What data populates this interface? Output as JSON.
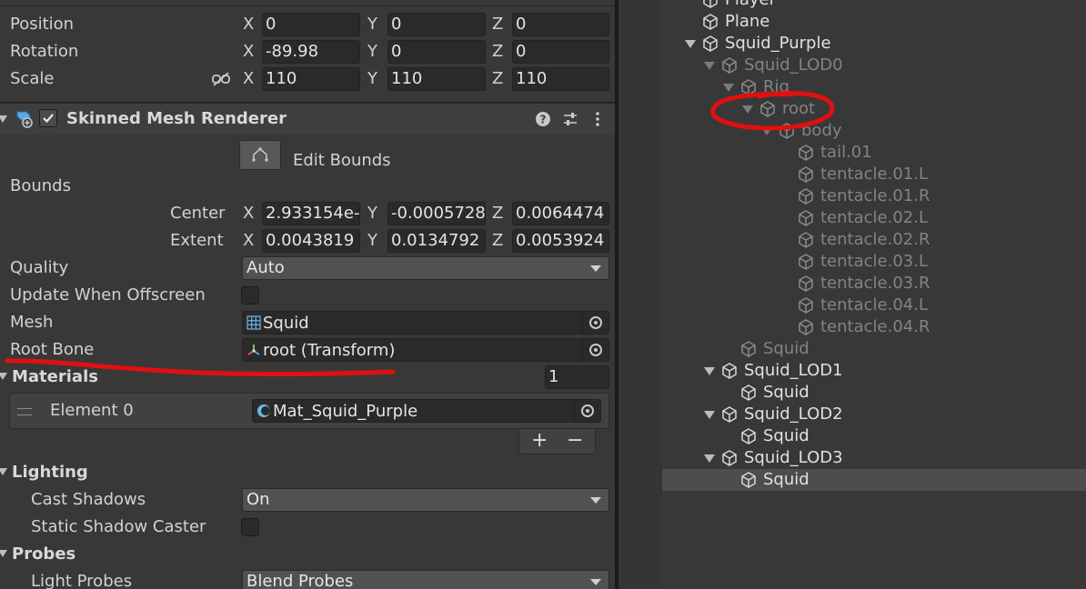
{
  "transform": {
    "position": {
      "label": "Position",
      "x": "0",
      "y": "0",
      "z": "0"
    },
    "rotation": {
      "label": "Rotation",
      "x": "-89.98",
      "y": "0",
      "z": "0"
    },
    "scale": {
      "label": "Scale",
      "x": "110",
      "y": "110",
      "z": "110"
    },
    "axis_x": "X",
    "axis_y": "Y",
    "axis_z": "Z"
  },
  "component": {
    "title": "Skinned Mesh Renderer",
    "edit_bounds": "Edit Bounds",
    "bounds_label": "Bounds",
    "center": {
      "label": "Center",
      "x": "2.933154e-",
      "y": "-0.0005728",
      "z": "0.0064474"
    },
    "extent": {
      "label": "Extent",
      "x": "0.0043819",
      "y": "0.0134792",
      "z": "0.0053924"
    },
    "quality": {
      "label": "Quality",
      "value": "Auto"
    },
    "update_offscreen": {
      "label": "Update When Offscreen"
    },
    "mesh": {
      "label": "Mesh",
      "value": "Squid"
    },
    "root_bone": {
      "label": "Root Bone",
      "value": "root (Transform)"
    },
    "materials": {
      "label": "Materials",
      "count": "1",
      "element_label": "Element 0",
      "element_value": "Mat_Squid_Purple",
      "add": "+",
      "remove": "−"
    },
    "lighting": {
      "label": "Lighting",
      "cast_shadows": "Cast Shadows",
      "cast_shadows_value": "On",
      "static_shadow": "Static Shadow Caster"
    },
    "probes": {
      "label": "Probes",
      "light_probes": "Light Probes",
      "light_probes_value": "Blend Probes"
    }
  },
  "hierarchy": [
    {
      "label": "Player"
    },
    {
      "label": "Plane"
    },
    {
      "label": "Squid_Purple"
    },
    {
      "label": "Squid_LOD0"
    },
    {
      "label": "Rig"
    },
    {
      "label": "root"
    },
    {
      "label": "body"
    },
    {
      "label": "tail.01"
    },
    {
      "label": "tentacle.01.L"
    },
    {
      "label": "tentacle.01.R"
    },
    {
      "label": "tentacle.02.L"
    },
    {
      "label": "tentacle.02.R"
    },
    {
      "label": "tentacle.03.L"
    },
    {
      "label": "tentacle.03.R"
    },
    {
      "label": "tentacle.04.L"
    },
    {
      "label": "tentacle.04.R"
    },
    {
      "label": "Squid"
    },
    {
      "label": "Squid_LOD1"
    },
    {
      "label": "Squid"
    },
    {
      "label": "Squid_LOD2"
    },
    {
      "label": "Squid"
    },
    {
      "label": "Squid_LOD3"
    },
    {
      "label": "Squid"
    }
  ],
  "colors": {
    "annotation": "#e01010",
    "panel": "#383838",
    "field": "#2a2a2a",
    "selected_row": "#4d4d4d"
  }
}
